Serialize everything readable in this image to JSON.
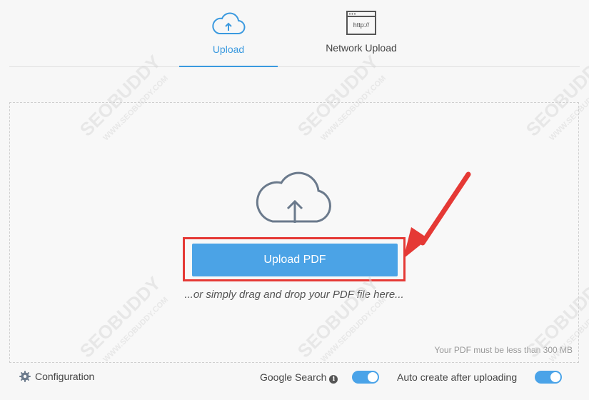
{
  "tabs": [
    {
      "label": "Upload",
      "icon": "cloud-upload-icon",
      "active": true
    },
    {
      "label": "Network Upload",
      "icon": "browser-http-icon",
      "icon_text": "http://"
    }
  ],
  "dropzone": {
    "icon": "cloud-upload-icon",
    "button_label": "Upload PDF",
    "drag_text": "...or simply drag and drop your PDF file here...",
    "limit_text": "Your PDF must be less than 300 MB"
  },
  "footer": {
    "config_label": "Configuration",
    "google_search_label": "Google Search",
    "google_search_enabled": true,
    "auto_create_label": "Auto create after uploading",
    "auto_create_enabled": true
  },
  "watermark": {
    "brand": "SEOBUDDY",
    "site": "WWW.SEOBUDDY.COM"
  },
  "colors": {
    "accent": "#4ba3e6",
    "annotation": "#e53935"
  }
}
